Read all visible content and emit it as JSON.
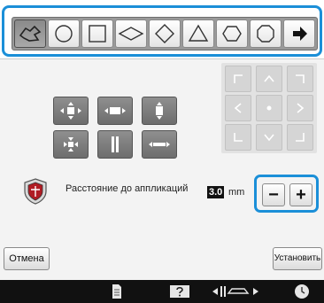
{
  "shape_toolbar": {
    "buttons": [
      {
        "icon": "freeform-shape-icon",
        "selected": true
      },
      {
        "icon": "circle-shape-icon",
        "selected": false
      },
      {
        "icon": "square-shape-icon",
        "selected": false
      },
      {
        "icon": "wide-diamond-shape-icon",
        "selected": false
      },
      {
        "icon": "diamond-shape-icon",
        "selected": false
      },
      {
        "icon": "triangle-shape-icon",
        "selected": false
      },
      {
        "icon": "hexagon-shape-icon",
        "selected": false
      },
      {
        "icon": "octagon-shape-icon",
        "selected": false
      },
      {
        "icon": "next-arrow-icon",
        "selected": false
      }
    ]
  },
  "mode_buttons": [
    "expand-all-icon",
    "expand-horizontal-icon",
    "expand-vertical-icon",
    "contract-all-icon",
    "contract-vertical-icon",
    "contract-horizontal-icon"
  ],
  "direction_pad": [
    "corner-top-left-icon",
    "arrow-up-icon",
    "corner-top-right-icon",
    "arrow-left-icon",
    "center-dot-icon",
    "arrow-right-icon",
    "corner-bottom-left-icon",
    "arrow-down-icon",
    "corner-bottom-right-icon"
  ],
  "distance": {
    "label": "Расстояние до аппликаций",
    "value": "3.0",
    "unit": "mm",
    "minus_label": "−",
    "plus_label": "+"
  },
  "actions": {
    "cancel_label": "Отмена",
    "set_label": "Установить"
  },
  "bottom_bar": {
    "icons": [
      "document-icon",
      "help-icon",
      "thread-tension-icon",
      "clock-icon"
    ]
  },
  "colors": {
    "highlight": "#1b8fd8",
    "bottom_bar": "#111111",
    "panel": "#f3f3f3"
  }
}
